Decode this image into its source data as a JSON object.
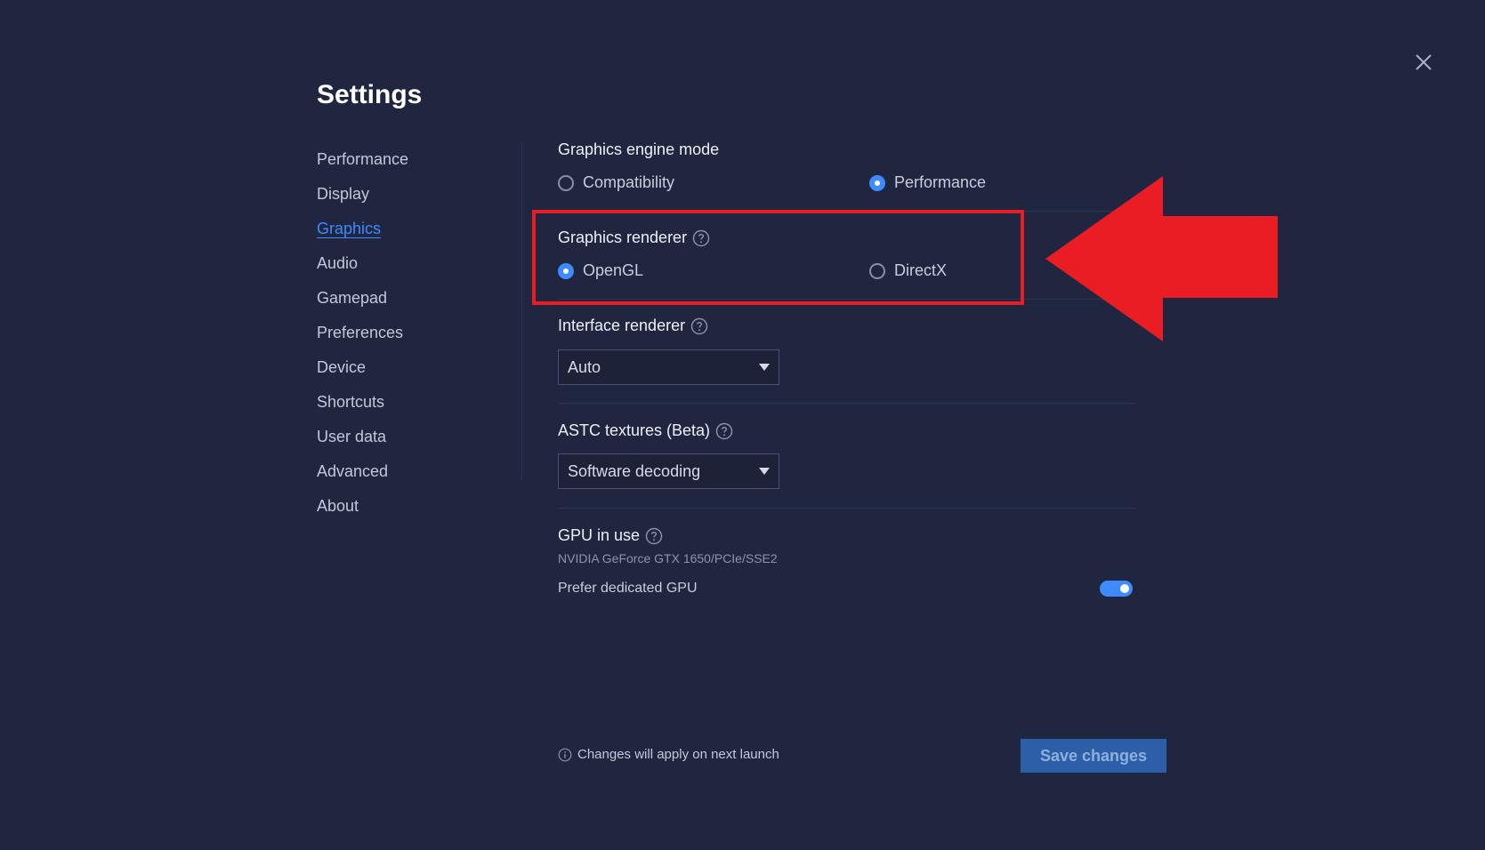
{
  "window": {
    "title": "Settings",
    "close_icon": "close-icon"
  },
  "sidebar": {
    "items": [
      {
        "label": "Performance",
        "active": false
      },
      {
        "label": "Display",
        "active": false
      },
      {
        "label": "Graphics",
        "active": true
      },
      {
        "label": "Audio",
        "active": false
      },
      {
        "label": "Gamepad",
        "active": false
      },
      {
        "label": "Preferences",
        "active": false
      },
      {
        "label": "Device",
        "active": false
      },
      {
        "label": "Shortcuts",
        "active": false
      },
      {
        "label": "User data",
        "active": false
      },
      {
        "label": "Advanced",
        "active": false
      },
      {
        "label": "About",
        "active": false
      }
    ]
  },
  "graphics": {
    "engine_mode": {
      "label": "Graphics engine mode",
      "options": [
        "Compatibility",
        "Performance"
      ],
      "selected": "Performance"
    },
    "renderer": {
      "label": "Graphics renderer",
      "options": [
        "OpenGL",
        "DirectX"
      ],
      "selected": "OpenGL"
    },
    "interface_renderer": {
      "label": "Interface renderer",
      "value": "Auto"
    },
    "astc": {
      "label": "ASTC textures (Beta)",
      "value": "Software decoding"
    },
    "gpu": {
      "label": "GPU in use",
      "name": "NVIDIA GeForce GTX 1650/PCIe/SSE2",
      "prefer_label": "Prefer dedicated GPU",
      "prefer_enabled": true
    }
  },
  "footer": {
    "note": "Changes will apply on next launch",
    "save_label": "Save changes"
  },
  "colors": {
    "background": "#212640",
    "accent": "#3d8bff",
    "annotation": "#ea1c24"
  }
}
